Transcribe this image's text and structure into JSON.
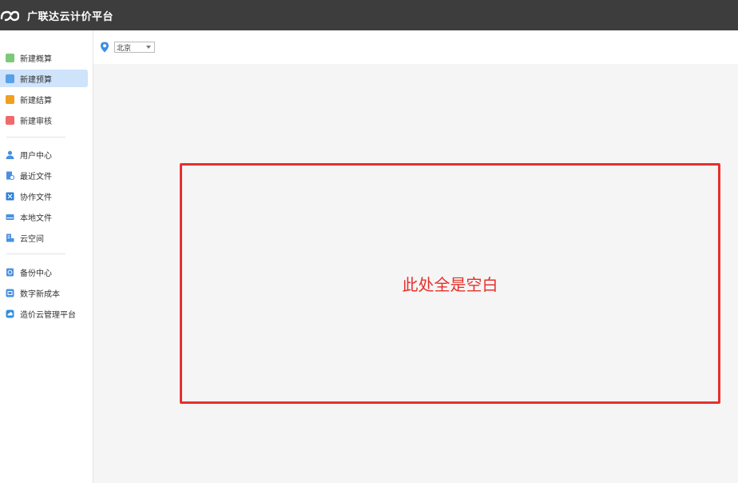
{
  "app": {
    "title": "广联达云计价平台",
    "logo_icon": "cloud-logo-icon"
  },
  "sidebar": {
    "groups": [
      [
        {
          "label": "新建概算",
          "icon": "new-estimate-icon",
          "color": "#7ec87a"
        },
        {
          "label": "新建预算",
          "icon": "new-budget-icon",
          "color": "#5aa0e8",
          "active": true
        },
        {
          "label": "新建结算",
          "icon": "new-settlement-icon",
          "color": "#f0a020"
        },
        {
          "label": "新建审核",
          "icon": "new-review-icon",
          "color": "#f06a6a"
        }
      ],
      [
        {
          "label": "用户中心",
          "icon": "user-icon",
          "color": "#4a90e2"
        },
        {
          "label": "最近文件",
          "icon": "recent-files-icon",
          "color": "#4a90e2"
        },
        {
          "label": "协作文件",
          "icon": "collab-files-icon",
          "color": "#2f7fd8"
        },
        {
          "label": "本地文件",
          "icon": "local-files-icon",
          "color": "#4a90e2"
        },
        {
          "label": "云空间",
          "icon": "cloud-space-icon",
          "color": "#4a90e2"
        }
      ],
      [
        {
          "label": "备份中心",
          "icon": "backup-icon",
          "color": "#4a90e2"
        },
        {
          "label": "数字新成本",
          "icon": "digital-cost-icon",
          "color": "#4a90e2"
        },
        {
          "label": "造价云管理平台",
          "icon": "cost-cloud-icon",
          "color": "#2f8fe0"
        }
      ]
    ]
  },
  "topbar": {
    "location_icon": "location-pin-icon",
    "city": "北京"
  },
  "content": {
    "annotation": "此处全是空白",
    "annotation_color": "#e8302b"
  }
}
